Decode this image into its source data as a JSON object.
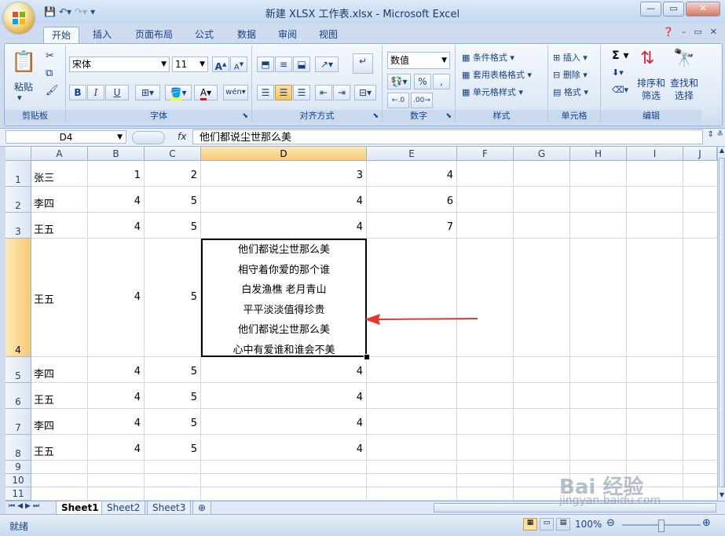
{
  "window": {
    "title": "新建 XLSX 工作表.xlsx - Microsoft Excel"
  },
  "ribbon_tabs": [
    "开始",
    "插入",
    "页面布局",
    "公式",
    "数据",
    "审阅",
    "视图"
  ],
  "clipboard": {
    "paste": "粘贴",
    "label": "剪贴板"
  },
  "font": {
    "name": "宋体",
    "size": "11",
    "label": "字体",
    "bold": "B",
    "italic": "I",
    "underline": "U"
  },
  "alignment": {
    "label": "对齐方式"
  },
  "number": {
    "format": "数值",
    "percent": "%",
    "comma": ",",
    "label": "数字"
  },
  "styles": {
    "conditional": "条件格式",
    "table": "套用表格格式",
    "cell": "单元格样式",
    "label": "样式"
  },
  "cells_group": {
    "insert": "插入",
    "delete": "删除",
    "format": "格式",
    "label": "单元格"
  },
  "editing": {
    "sort": "排序和\n筛选",
    "find": "查找和\n选择",
    "label": "编辑",
    "sigma": "Σ"
  },
  "formula_bar": {
    "cell_ref": "D4",
    "fx": "fx",
    "content": "他们都说尘世那么美"
  },
  "columns": [
    "A",
    "B",
    "C",
    "D",
    "E",
    "F",
    "G",
    "H",
    "I",
    "J"
  ],
  "rows": [
    {
      "num": "1",
      "a": "张三",
      "b": "1",
      "c": "2",
      "d": "3",
      "e": "4"
    },
    {
      "num": "2",
      "a": "李四",
      "b": "4",
      "c": "5",
      "d": "4",
      "e": "6"
    },
    {
      "num": "3",
      "a": "王五",
      "b": "4",
      "c": "5",
      "d": "4",
      "e": "7"
    },
    {
      "num": "4",
      "a": "王五",
      "b": "4",
      "c": "5",
      "d": "",
      "e": ""
    },
    {
      "num": "5",
      "a": "李四",
      "b": "4",
      "c": "5",
      "d": "4",
      "e": ""
    },
    {
      "num": "6",
      "a": "王五",
      "b": "4",
      "c": "5",
      "d": "4",
      "e": ""
    },
    {
      "num": "7",
      "a": "李四",
      "b": "4",
      "c": "5",
      "d": "4",
      "e": ""
    },
    {
      "num": "8",
      "a": "王五",
      "b": "4",
      "c": "5",
      "d": "4",
      "e": ""
    },
    {
      "num": "9",
      "a": "",
      "b": "",
      "c": "",
      "d": "",
      "e": ""
    },
    {
      "num": "10",
      "a": "",
      "b": "",
      "c": "",
      "d": "",
      "e": ""
    },
    {
      "num": "11",
      "a": "",
      "b": "",
      "c": "",
      "d": "",
      "e": ""
    }
  ],
  "d4_lines": [
    "他们都说尘世那么美",
    "相守着你爱的那个谁",
    "白发渔樵  老月青山",
    "平平淡淡值得珍贵",
    "他们都说尘世那么美",
    "心中有爱谁和谁会不美"
  ],
  "sheets": [
    "Sheet1",
    "Sheet2",
    "Sheet3"
  ],
  "status": {
    "ready": "就绪",
    "zoom": "100%"
  },
  "watermark": {
    "brand": "Bai 经验",
    "url": "jingyan.baidu.com"
  },
  "colors": {
    "arrow": "#e8352f",
    "accent": "#15428b"
  }
}
